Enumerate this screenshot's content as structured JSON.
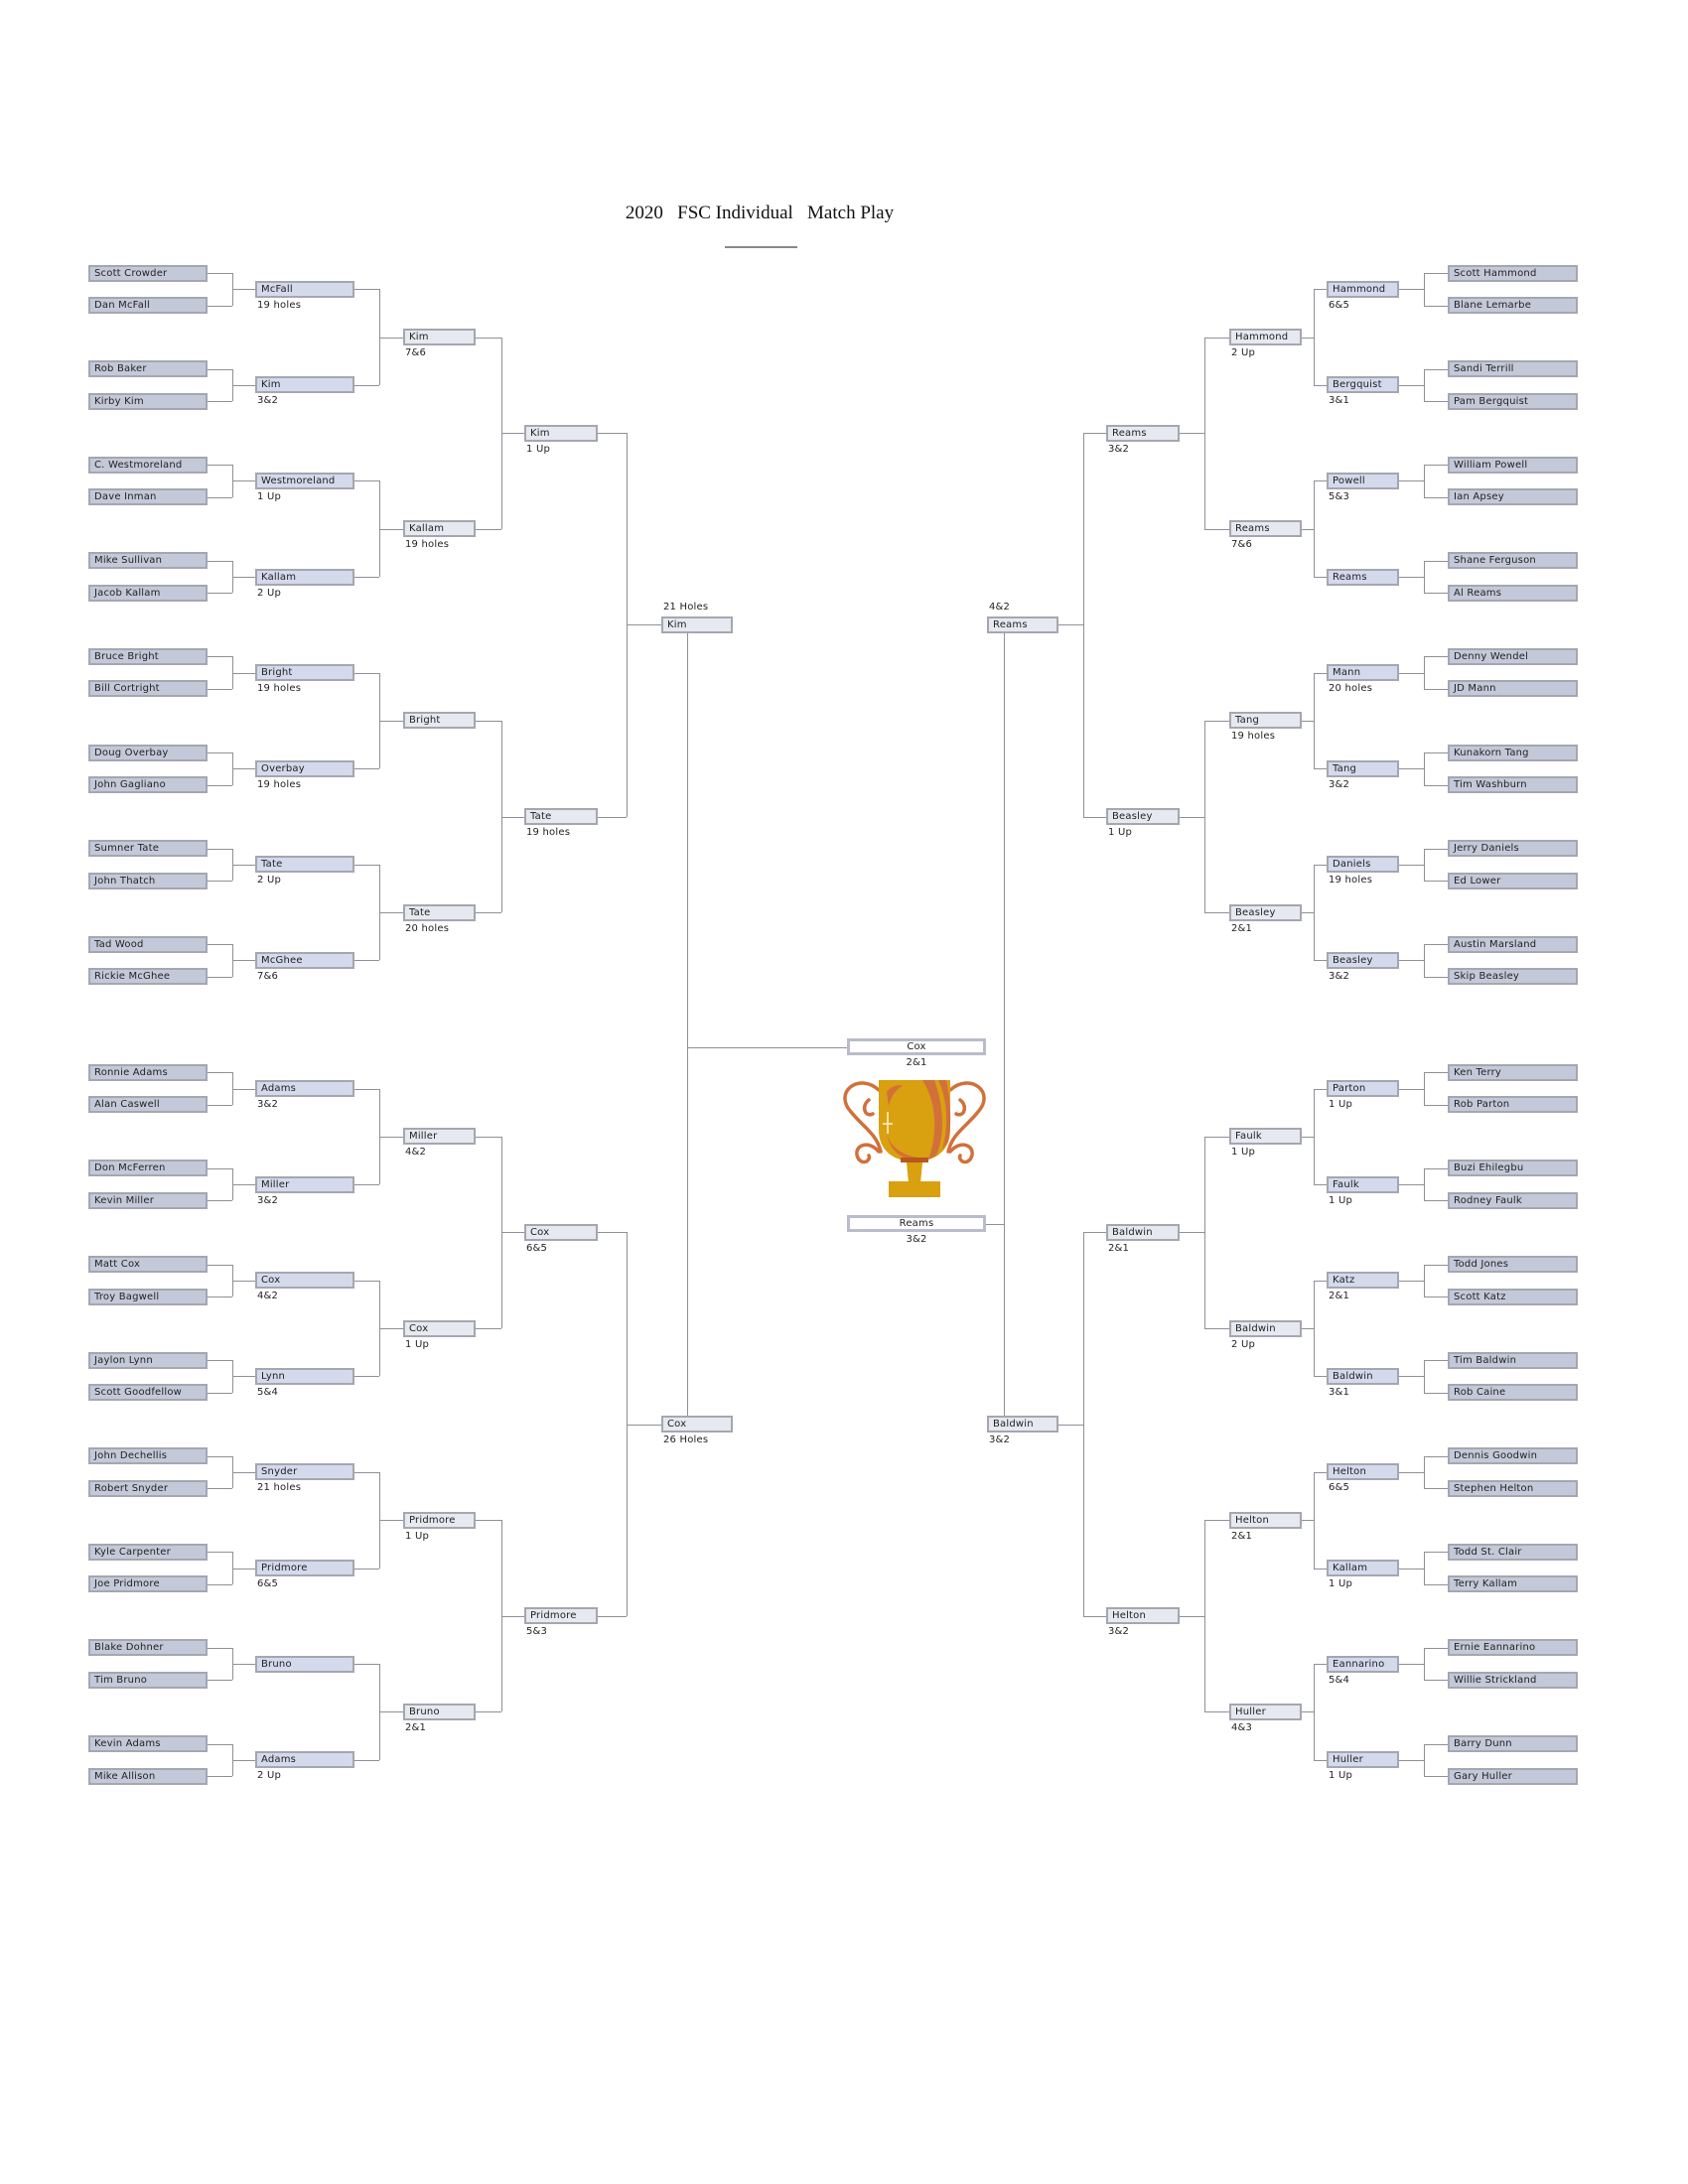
{
  "title": "2020   FSC Individual   Match Play",
  "colors": {
    "round1_box": "#c4c9d9",
    "round2_box": "#d4d9ec",
    "later_box": "#e7e9f1",
    "border": "#a4a7b0",
    "trophy_gold": "#d9a010",
    "trophy_orange": "#d2703a"
  },
  "trophy_icon": "trophy-icon",
  "left": {
    "rounds": [
      [
        {
          "name": "Scott Crowder"
        },
        {
          "name": "Dan McFall"
        },
        {
          "name": "Rob Baker"
        },
        {
          "name": "Kirby Kim"
        },
        {
          "name": "C. Westmoreland"
        },
        {
          "name": "Dave Inman"
        },
        {
          "name": "Mike Sullivan"
        },
        {
          "name": "Jacob Kallam"
        },
        {
          "name": "Bruce Bright"
        },
        {
          "name": "Bill Cortright"
        },
        {
          "name": "Doug Overbay"
        },
        {
          "name": "John Gagliano"
        },
        {
          "name": "Sumner Tate"
        },
        {
          "name": "John Thatch"
        },
        {
          "name": "Tad Wood"
        },
        {
          "name": "Rickie McGhee"
        },
        {
          "name": "Ronnie Adams"
        },
        {
          "name": "Alan Caswell"
        },
        {
          "name": "Don McFerren"
        },
        {
          "name": "Kevin Miller"
        },
        {
          "name": "Matt Cox"
        },
        {
          "name": "Troy Bagwell"
        },
        {
          "name": "Jaylon Lynn"
        },
        {
          "name": "Scott Goodfellow"
        },
        {
          "name": "John Dechellis"
        },
        {
          "name": "Robert Snyder"
        },
        {
          "name": "Kyle Carpenter"
        },
        {
          "name": "Joe Pridmore"
        },
        {
          "name": "Blake Dohner"
        },
        {
          "name": "Tim Bruno"
        },
        {
          "name": "Kevin Adams"
        },
        {
          "name": "Mike Allison"
        }
      ],
      [
        {
          "name": "McFall",
          "score": "19 holes"
        },
        {
          "name": "Kim",
          "score": "3&2"
        },
        {
          "name": "Westmoreland",
          "score": "1 Up"
        },
        {
          "name": "Kallam",
          "score": "2 Up"
        },
        {
          "name": "Bright",
          "score": "19 holes"
        },
        {
          "name": "Overbay",
          "score": "19 holes"
        },
        {
          "name": "Tate",
          "score": "2 Up"
        },
        {
          "name": "McGhee",
          "score": "7&6"
        },
        {
          "name": "Adams",
          "score": "3&2"
        },
        {
          "name": "Miller",
          "score": "3&2"
        },
        {
          "name": "Cox",
          "score": "4&2"
        },
        {
          "name": "Lynn",
          "score": "5&4"
        },
        {
          "name": "Snyder",
          "score": "21 holes"
        },
        {
          "name": "Pridmore",
          "score": "6&5"
        },
        {
          "name": "Bruno",
          "score": ""
        },
        {
          "name": "Adams",
          "score": "2 Up"
        }
      ],
      [
        {
          "name": "Kim",
          "score": "7&6"
        },
        {
          "name": "Kallam",
          "score": "19 holes"
        },
        {
          "name": "Bright",
          "score": ""
        },
        {
          "name": "Tate",
          "score": "20 holes"
        },
        {
          "name": "Miller",
          "score": "4&2"
        },
        {
          "name": "Cox",
          "score": "1 Up"
        },
        {
          "name": "Pridmore",
          "score": "1 Up"
        },
        {
          "name": "Bruno",
          "score": "2&1"
        }
      ],
      [
        {
          "name": "Kim",
          "score": "1 Up"
        },
        {
          "name": "Tate",
          "score": "19 holes"
        },
        {
          "name": "Cox",
          "score": "6&5"
        },
        {
          "name": "Pridmore",
          "score": "5&3"
        }
      ]
    ],
    "semis": [
      {
        "name": "Kim",
        "score": "21 Holes",
        "score_position": "above"
      },
      {
        "name": "Cox",
        "score": "26 Holes",
        "score_position": "below"
      }
    ]
  },
  "right": {
    "rounds": [
      [
        {
          "name": "Scott Hammond"
        },
        {
          "name": "Blane Lemarbe"
        },
        {
          "name": "Sandi Terrill"
        },
        {
          "name": "Pam Bergquist"
        },
        {
          "name": "William Powell"
        },
        {
          "name": "Ian Apsey"
        },
        {
          "name": "Shane Ferguson"
        },
        {
          "name": "Al Reams"
        },
        {
          "name": "Denny Wendel"
        },
        {
          "name": "JD Mann"
        },
        {
          "name": "Kunakorn Tang"
        },
        {
          "name": "Tim Washburn"
        },
        {
          "name": "Jerry Daniels"
        },
        {
          "name": "Ed Lower"
        },
        {
          "name": "Austin Marsland"
        },
        {
          "name": "Skip Beasley"
        },
        {
          "name": "Ken Terry"
        },
        {
          "name": "Rob Parton"
        },
        {
          "name": "Buzi Ehilegbu"
        },
        {
          "name": "Rodney Faulk"
        },
        {
          "name": "Todd Jones"
        },
        {
          "name": "Scott Katz"
        },
        {
          "name": "Tim Baldwin"
        },
        {
          "name": "Rob Caine"
        },
        {
          "name": "Dennis Goodwin"
        },
        {
          "name": "Stephen Helton"
        },
        {
          "name": "Todd St. Clair"
        },
        {
          "name": "Terry Kallam"
        },
        {
          "name": "Ernie Eannarino"
        },
        {
          "name": "Willie Strickland"
        },
        {
          "name": "Barry Dunn"
        },
        {
          "name": "Gary Huller"
        }
      ],
      [
        {
          "name": "Hammond",
          "score": "6&5"
        },
        {
          "name": "Bergquist",
          "score": "3&1"
        },
        {
          "name": "Powell",
          "score": "5&3"
        },
        {
          "name": "Reams",
          "score": ""
        },
        {
          "name": "Mann",
          "score": "20 holes"
        },
        {
          "name": "Tang",
          "score": "3&2"
        },
        {
          "name": "Daniels",
          "score": "19 holes"
        },
        {
          "name": "Beasley",
          "score": "3&2"
        },
        {
          "name": "Parton",
          "score": "1 Up"
        },
        {
          "name": "Faulk",
          "score": "1 Up"
        },
        {
          "name": "Katz",
          "score": "2&1"
        },
        {
          "name": "Baldwin",
          "score": "3&1"
        },
        {
          "name": "Helton",
          "score": "6&5"
        },
        {
          "name": "Kallam",
          "score": "1 Up"
        },
        {
          "name": "Eannarino",
          "score": "5&4"
        },
        {
          "name": "Huller",
          "score": "1 Up"
        }
      ],
      [
        {
          "name": "Hammond",
          "score": "2 Up"
        },
        {
          "name": "Reams",
          "score": "7&6"
        },
        {
          "name": "Tang",
          "score": "19 holes"
        },
        {
          "name": "Beasley",
          "score": "2&1"
        },
        {
          "name": "Faulk",
          "score": "1 Up"
        },
        {
          "name": "Baldwin",
          "score": "2 Up"
        },
        {
          "name": "Helton",
          "score": "2&1"
        },
        {
          "name": "Huller",
          "score": "4&3"
        }
      ],
      [
        {
          "name": "Reams",
          "score": "3&2"
        },
        {
          "name": "Beasley",
          "score": "1 Up"
        },
        {
          "name": "Baldwin",
          "score": "2&1"
        },
        {
          "name": "Helton",
          "score": "3&2"
        }
      ]
    ],
    "semis": [
      {
        "name": "Reams",
        "score": "4&2",
        "score_position": "above"
      },
      {
        "name": "Baldwin",
        "score": "3&2",
        "score_position": "below"
      }
    ]
  },
  "final": [
    {
      "name": "Cox",
      "score": "2&1"
    },
    {
      "name": "Reams",
      "score": "3&2"
    }
  ]
}
